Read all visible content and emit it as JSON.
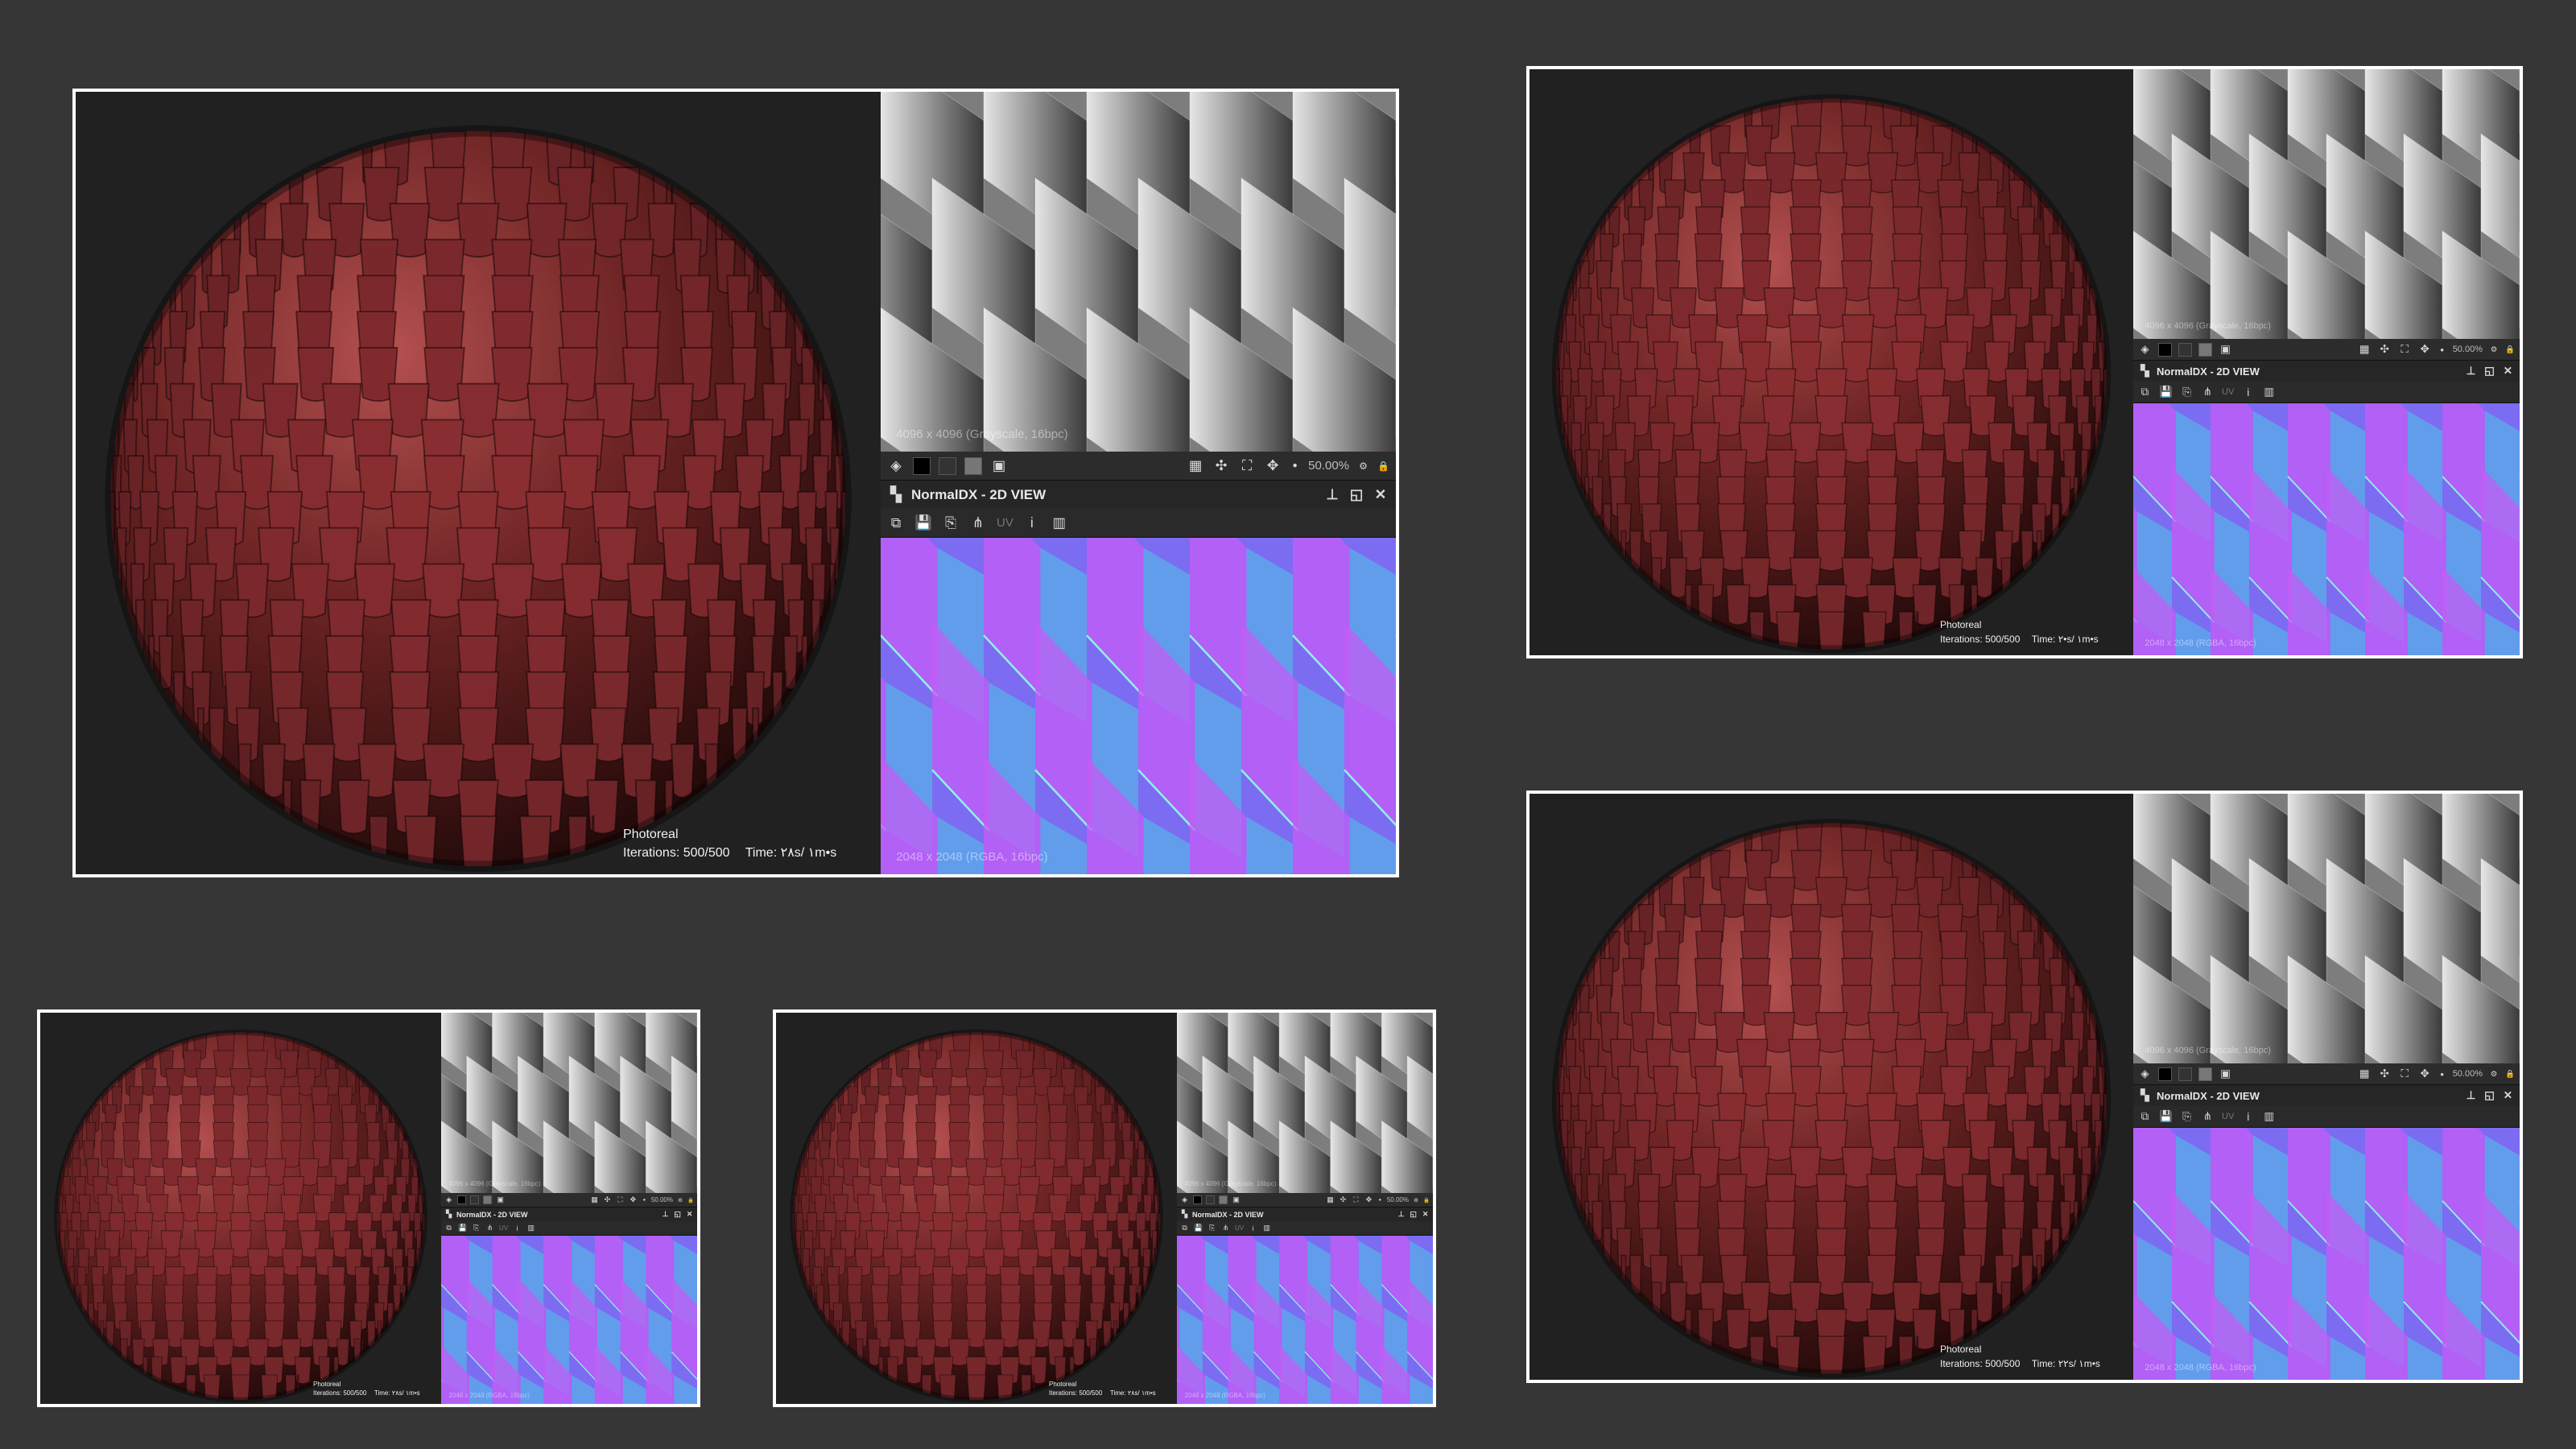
{
  "colors": {
    "background": "#363636",
    "card_border": "#ffffff",
    "viewport_bg": "#212121",
    "sphere_base": "#6e2424",
    "sphere_highlight": "#b55050",
    "sphere_shadow": "#1f0808",
    "normal_base": "#7c6cf2",
    "normal_magenta": "#c45cf5",
    "normal_cyan": "#4cc7e8",
    "toolbar_bg": "#2c2c2c"
  },
  "icons": {
    "panel_icon": "checker-panel-icon",
    "pin": "pin-icon",
    "maximize": "maximize-icon",
    "close": "close-icon",
    "layers": "layers-icon",
    "grid": "grid-icon",
    "info": "info-icon",
    "histogram": "histogram-icon",
    "save": "save-icon"
  },
  "renders": [
    {
      "id": "main",
      "render_mode": "Photoreal",
      "iterations": "Iterations: 500/500",
      "time": "Time: ٢٨s/ ١m•s",
      "height_map_info": "4096 x 4096 (Grayscale, 16bpc)",
      "zoom": "50.00%",
      "panel_title": "NormalDX - 2D VIEW",
      "uv_label": "UV",
      "normal_map_info": "2048 x 2048 (RGBA, 16bpc)"
    },
    {
      "id": "top-right",
      "render_mode": "Photoreal",
      "iterations": "Iterations: 500/500",
      "time": "Time: ٢•s/ ١m•s",
      "height_map_info": "4096 x 4096 (Grayscale, 16bpc)",
      "zoom": "50.00%",
      "panel_title": "NormalDX - 2D VIEW",
      "uv_label": "UV",
      "normal_map_info": "2048 x 2048 (RGBA, 16bpc)"
    },
    {
      "id": "bottom-right",
      "render_mode": "Photoreal",
      "iterations": "Iterations: 500/500",
      "time": "Time: ٢٢s/ ١m•s",
      "height_map_info": "4096 x 4096 (Grayscale, 16bpc)",
      "zoom": "50.00%",
      "panel_title": "NormalDX - 2D VIEW",
      "uv_label": "UV",
      "normal_map_info": "2048 x 2048 (RGBA, 16bpc)"
    },
    {
      "id": "bottom-left",
      "render_mode": "Photoreal",
      "iterations": "Iterations: 500/500",
      "time": "Time: ٢٨s/ ١m•s",
      "height_map_info": "4096 x 4096 (Grayscale, 16bpc)",
      "zoom": "50.00%",
      "panel_title": "NormalDX - 2D VIEW",
      "uv_label": "UV",
      "normal_map_info": "2048 x 2048 (RGBA, 16bpc)"
    },
    {
      "id": "bottom-middle",
      "render_mode": "Photoreal",
      "iterations": "Iterations: 500/500",
      "time": "Time: ٢٨s/ ١m•s",
      "height_map_info": "4096 x 4096 (Grayscale, 16bpc)",
      "zoom": "50.00%",
      "panel_title": "NormalDX - 2D VIEW",
      "uv_label": "UV",
      "normal_map_info": "2048 x 2048 (RGBA, 16bpc)"
    }
  ]
}
